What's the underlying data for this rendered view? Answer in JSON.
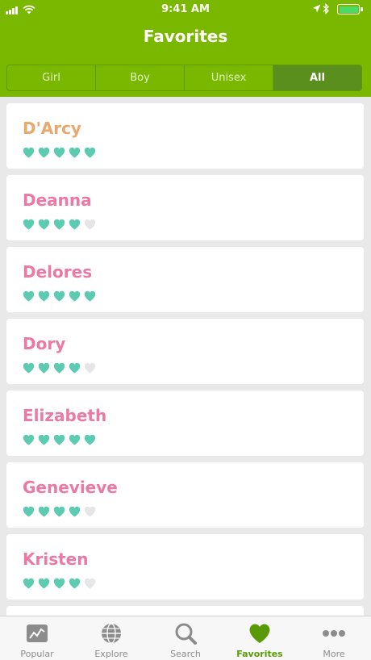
{
  "status_bar": {
    "time": "9:41 AM"
  },
  "header": {
    "title": "Favorites"
  },
  "segments": [
    {
      "label": "Girl",
      "active": false
    },
    {
      "label": "Boy",
      "active": false
    },
    {
      "label": "Unisex",
      "active": false
    },
    {
      "label": "All",
      "active": true
    }
  ],
  "favorites": [
    {
      "name": "D'Arcy",
      "color": "#e8a96e",
      "rating": 5,
      "max": 5
    },
    {
      "name": "Deanna",
      "color": "#ea7aa5",
      "rating": 4,
      "max": 5
    },
    {
      "name": "Delores",
      "color": "#ea7aa5",
      "rating": 5,
      "max": 5
    },
    {
      "name": "Dory",
      "color": "#ea7aa5",
      "rating": 4,
      "max": 5
    },
    {
      "name": "Elizabeth",
      "color": "#ea7aa5",
      "rating": 5,
      "max": 5
    },
    {
      "name": "Genevieve",
      "color": "#ea7aa5",
      "rating": 4,
      "max": 5
    },
    {
      "name": "Kristen",
      "color": "#ea7aa5",
      "rating": 4,
      "max": 5
    }
  ],
  "colors": {
    "header": "#7ab800",
    "heart_filled": "#5ccbb2",
    "heart_empty": "#e6e6e6",
    "tab_active": "#5a9a08",
    "tab_inactive": "#8c8c8c"
  },
  "tabs": [
    {
      "label": "Popular",
      "icon": "chart-icon",
      "active": false
    },
    {
      "label": "Explore",
      "icon": "globe-icon",
      "active": false
    },
    {
      "label": "Search",
      "icon": "search-icon",
      "active": false
    },
    {
      "label": "Favorites",
      "icon": "heart-icon",
      "active": true
    },
    {
      "label": "More",
      "icon": "more-icon",
      "active": false
    }
  ]
}
